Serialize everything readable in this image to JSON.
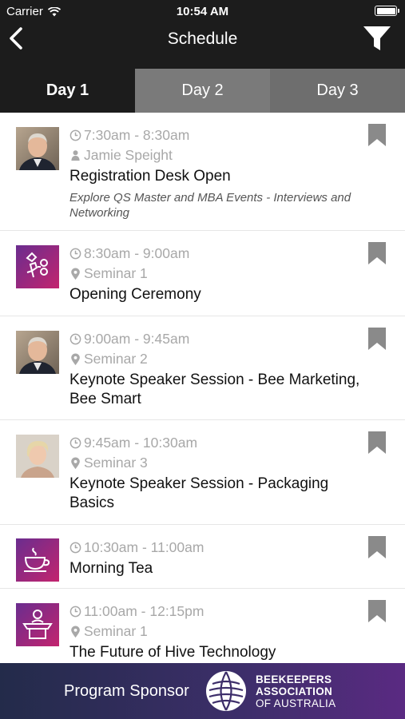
{
  "status_bar": {
    "carrier": "Carrier",
    "time": "10:54 AM"
  },
  "nav": {
    "title": "Schedule"
  },
  "tabs": [
    {
      "label": "Day 1"
    },
    {
      "label": "Day 2"
    },
    {
      "label": "Day 3"
    }
  ],
  "sessions": [
    {
      "time": "7:30am - 8:30am",
      "speaker": "Jamie Speight",
      "title": "Registration Desk Open",
      "description": "Explore QS Master and MBA Events - Interviews and Networking",
      "thumb_icon": "man-photo"
    },
    {
      "time": "8:30am - 9:00am",
      "location": "Seminar 1",
      "title": "Opening Ceremony",
      "thumb_icon": "ceremony-icon"
    },
    {
      "time": "9:00am - 9:45am",
      "location": "Seminar 2",
      "title": "Keynote Speaker Session - Bee Marketing, Bee Smart",
      "thumb_icon": "man-photo"
    },
    {
      "time": "9:45am - 10:30am",
      "location": "Seminar 3",
      "title": "Keynote Speaker Session - Packaging Basics",
      "thumb_icon": "woman-photo"
    },
    {
      "time": "10:30am - 11:00am",
      "title": "Morning Tea",
      "thumb_icon": "coffee-cup-icon"
    },
    {
      "time": "11:00am - 12:15pm",
      "location": "Seminar 1",
      "title": "The Future of Hive Technology",
      "thumb_icon": "podium-icon"
    }
  ],
  "sponsor": {
    "label": "Program Sponsor",
    "org_line1": "BEEKEEPERS",
    "org_line2": "ASSOCIATION",
    "org_line3": "OF AUSTRALIA"
  },
  "colors": {
    "header": "#1c1c1c",
    "tab_inactive": "#6e6e6e",
    "accent_purple": "#8e2a8c",
    "meta_gray": "#a8a8a8"
  }
}
